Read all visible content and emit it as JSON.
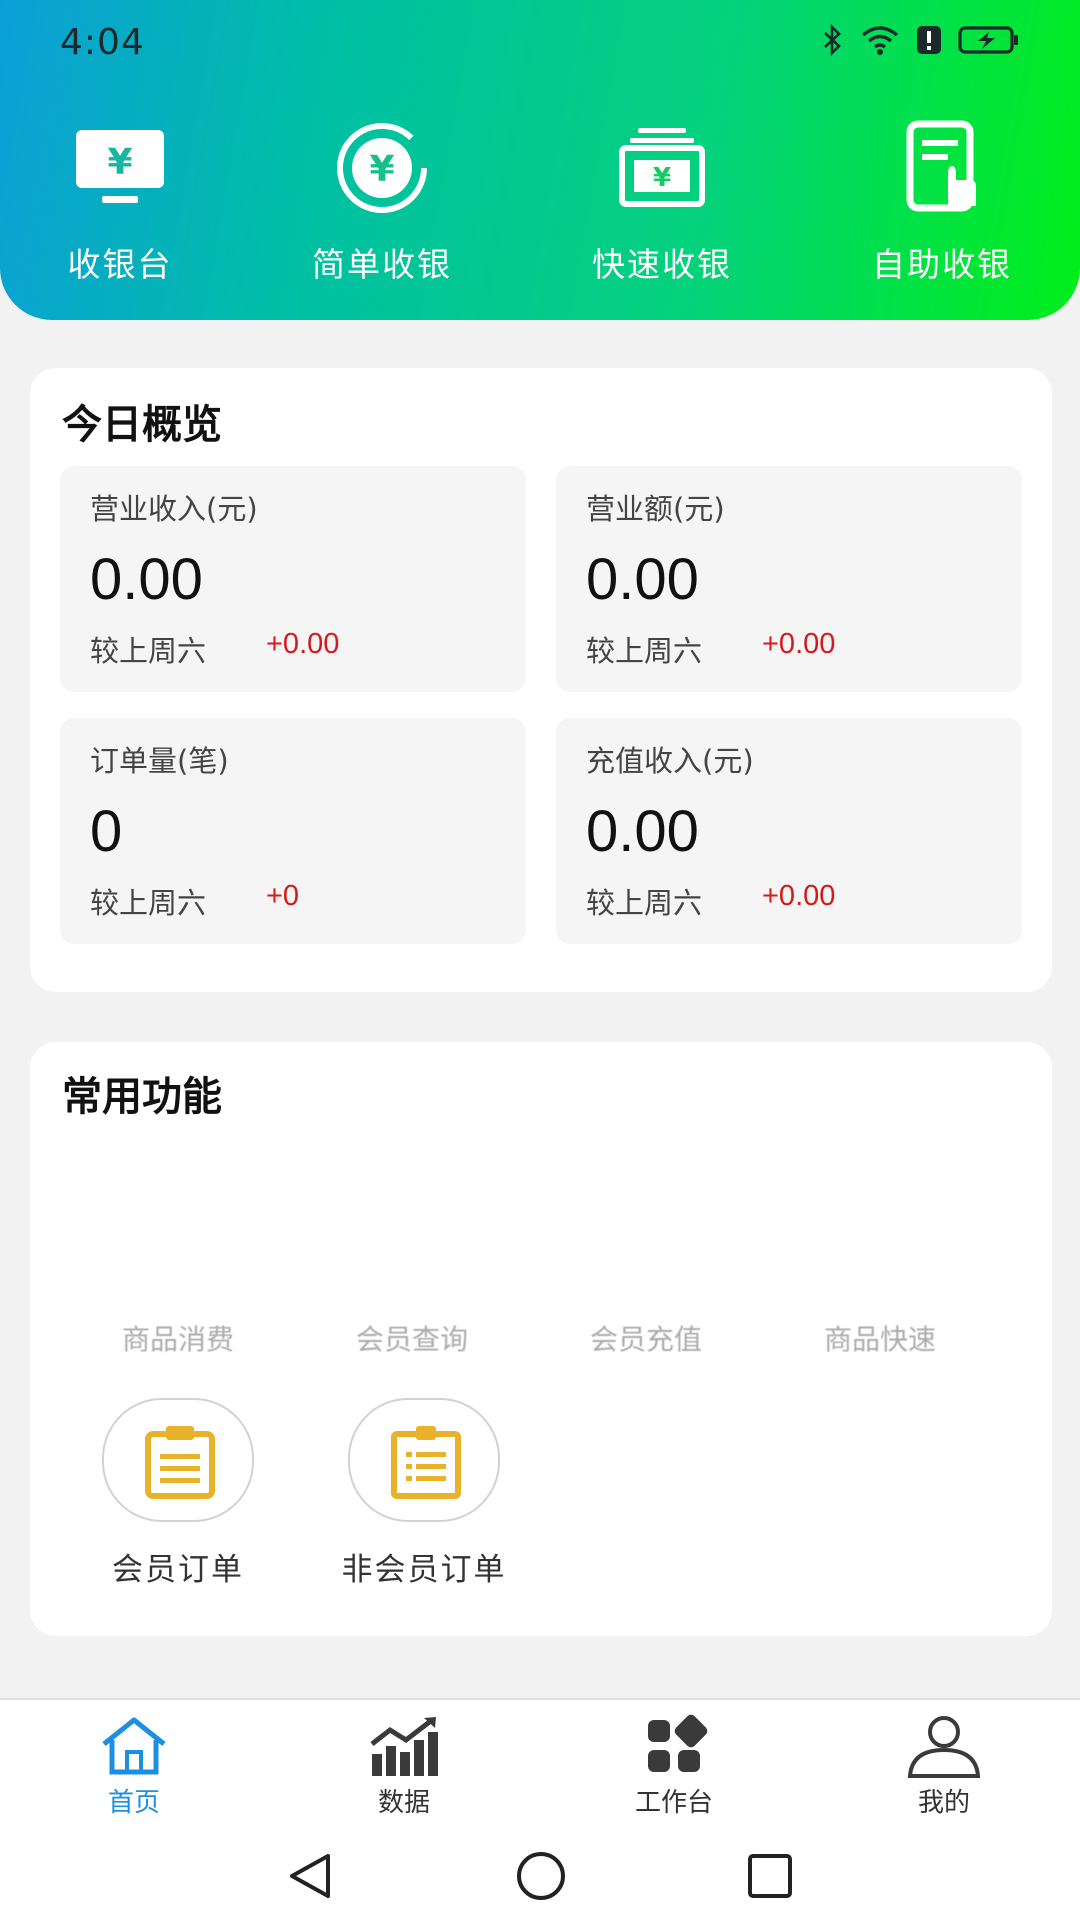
{
  "status_bar": {
    "time": "4:04"
  },
  "quick_actions": [
    {
      "label": "收银台",
      "icon": "cashier-monitor-icon"
    },
    {
      "label": "简单收银",
      "icon": "yen-circle-icon"
    },
    {
      "label": "快速收银",
      "icon": "yen-cash-stack-icon"
    },
    {
      "label": "自助收银",
      "icon": "self-service-tablet-icon"
    }
  ],
  "overview": {
    "title": "今日概览",
    "stats": [
      {
        "label": "营业收入(元)",
        "value": "0.00",
        "compare": "较上周六",
        "delta": "+0.00"
      },
      {
        "label": "营业额(元)",
        "value": "0.00",
        "compare": "较上周六",
        "delta": "+0.00"
      },
      {
        "label": "订单量(笔)",
        "value": "0",
        "compare": "较上周六",
        "delta": "+0"
      },
      {
        "label": "充值收入(元)",
        "value": "0.00",
        "compare": "较上周六",
        "delta": "+0.00"
      }
    ]
  },
  "common_functions": {
    "title": "常用功能",
    "faded_row": [
      "商品消费",
      "会员查询",
      "会员充值",
      "商品快速"
    ],
    "items": [
      {
        "label": "会员订单",
        "icon": "clipboard-icon"
      },
      {
        "label": "非会员订单",
        "icon": "clipboard-icon"
      }
    ]
  },
  "tabbar": {
    "items": [
      {
        "label": "首页",
        "icon": "home-icon",
        "active": true
      },
      {
        "label": "数据",
        "icon": "bar-chart-icon",
        "active": false
      },
      {
        "label": "工作台",
        "icon": "workbench-grid-icon",
        "active": false
      },
      {
        "label": "我的",
        "icon": "user-icon",
        "active": false
      }
    ]
  },
  "colors": {
    "accent": "#1c8fe0",
    "delta_red": "#d41a1a",
    "clipboard_gold": "#e8b22a",
    "header_gradient": [
      "#0b9fd8",
      "#00bfa4",
      "#00ee18"
    ]
  }
}
